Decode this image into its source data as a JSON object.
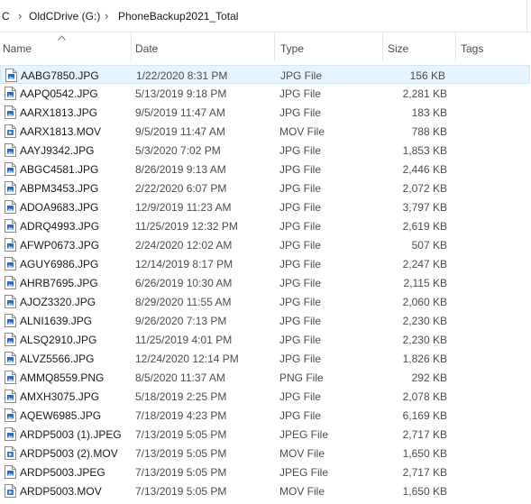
{
  "breadcrumb": [
    "C",
    "OldCDrive (G:)",
    "PhoneBackup2021_Total"
  ],
  "columns": {
    "name": "Name",
    "date": "Date",
    "type": "Type",
    "size": "Size",
    "tags": "Tags"
  },
  "sort": {
    "column": "name",
    "direction": "ascending"
  },
  "selected_index": 0,
  "files": [
    {
      "name": "AABG7850.JPG",
      "date": "1/22/2020 8:31 PM",
      "type": "JPG File",
      "size": "156 KB",
      "icon": "image-file-icon"
    },
    {
      "name": "AAPQ0542.JPG",
      "date": "5/13/2019 9:18 PM",
      "type": "JPG File",
      "size": "2,281 KB",
      "icon": "image-file-icon"
    },
    {
      "name": "AARX1813.JPG",
      "date": "9/5/2019 11:47 AM",
      "type": "JPG File",
      "size": "183 KB",
      "icon": "image-file-icon"
    },
    {
      "name": "AARX1813.MOV",
      "date": "9/5/2019 11:47 AM",
      "type": "MOV File",
      "size": "788 KB",
      "icon": "video-file-icon"
    },
    {
      "name": "AAYJ9342.JPG",
      "date": "5/3/2020 7:02 PM",
      "type": "JPG File",
      "size": "1,853 KB",
      "icon": "image-file-icon"
    },
    {
      "name": "ABGC4581.JPG",
      "date": "8/26/2019 9:13 AM",
      "type": "JPG File",
      "size": "2,446 KB",
      "icon": "image-file-icon"
    },
    {
      "name": "ABPM3453.JPG",
      "date": "2/22/2020 6:07 PM",
      "type": "JPG File",
      "size": "2,072 KB",
      "icon": "image-file-icon"
    },
    {
      "name": "ADOA9683.JPG",
      "date": "12/9/2019 11:23 AM",
      "type": "JPG File",
      "size": "3,797 KB",
      "icon": "image-file-icon"
    },
    {
      "name": "ADRQ4993.JPG",
      "date": "11/25/2019 12:32 PM",
      "type": "JPG File",
      "size": "2,619 KB",
      "icon": "image-file-icon"
    },
    {
      "name": "AFWP0673.JPG",
      "date": "2/24/2020 12:02 AM",
      "type": "JPG File",
      "size": "507 KB",
      "icon": "image-file-icon"
    },
    {
      "name": "AGUY6986.JPG",
      "date": "12/14/2019 8:17 PM",
      "type": "JPG File",
      "size": "2,247 KB",
      "icon": "image-file-icon"
    },
    {
      "name": "AHRB7695.JPG",
      "date": "6/26/2019 10:30 AM",
      "type": "JPG File",
      "size": "2,115 KB",
      "icon": "image-file-icon"
    },
    {
      "name": "AJOZ3320.JPG",
      "date": "8/29/2020 11:55 AM",
      "type": "JPG File",
      "size": "2,060 KB",
      "icon": "image-file-icon"
    },
    {
      "name": "ALNI1639.JPG",
      "date": "9/26/2020 7:13 PM",
      "type": "JPG File",
      "size": "2,230 KB",
      "icon": "image-file-icon"
    },
    {
      "name": "ALSQ2910.JPG",
      "date": "11/25/2019 4:01 PM",
      "type": "JPG File",
      "size": "2,230 KB",
      "icon": "image-file-icon"
    },
    {
      "name": "ALVZ5566.JPG",
      "date": "12/24/2020 12:14 PM",
      "type": "JPG File",
      "size": "1,826 KB",
      "icon": "image-file-icon"
    },
    {
      "name": "AMMQ8559.PNG",
      "date": "8/5/2020 11:37 AM",
      "type": "PNG File",
      "size": "292 KB",
      "icon": "image-file-icon"
    },
    {
      "name": "AMXH3075.JPG",
      "date": "5/18/2019 2:25 PM",
      "type": "JPG File",
      "size": "2,078 KB",
      "icon": "image-file-icon"
    },
    {
      "name": "AQEW6985.JPG",
      "date": "7/18/2019 4:23 PM",
      "type": "JPG File",
      "size": "6,169 KB",
      "icon": "image-file-icon"
    },
    {
      "name": "ARDP5003 (1).JPEG",
      "date": "7/13/2019 5:05 PM",
      "type": "JPEG File",
      "size": "2,717 KB",
      "icon": "image-file-icon"
    },
    {
      "name": "ARDP5003 (2).MOV",
      "date": "7/13/2019 5:05 PM",
      "type": "MOV File",
      "size": "1,650 KB",
      "icon": "video-file-icon"
    },
    {
      "name": "ARDP5003.JPEG",
      "date": "7/13/2019 5:05 PM",
      "type": "JPEG File",
      "size": "2,717 KB",
      "icon": "image-file-icon"
    },
    {
      "name": "ARDP5003.MOV",
      "date": "7/13/2019 5:05 PM",
      "type": "MOV File",
      "size": "1,650 KB",
      "icon": "video-file-icon"
    }
  ]
}
